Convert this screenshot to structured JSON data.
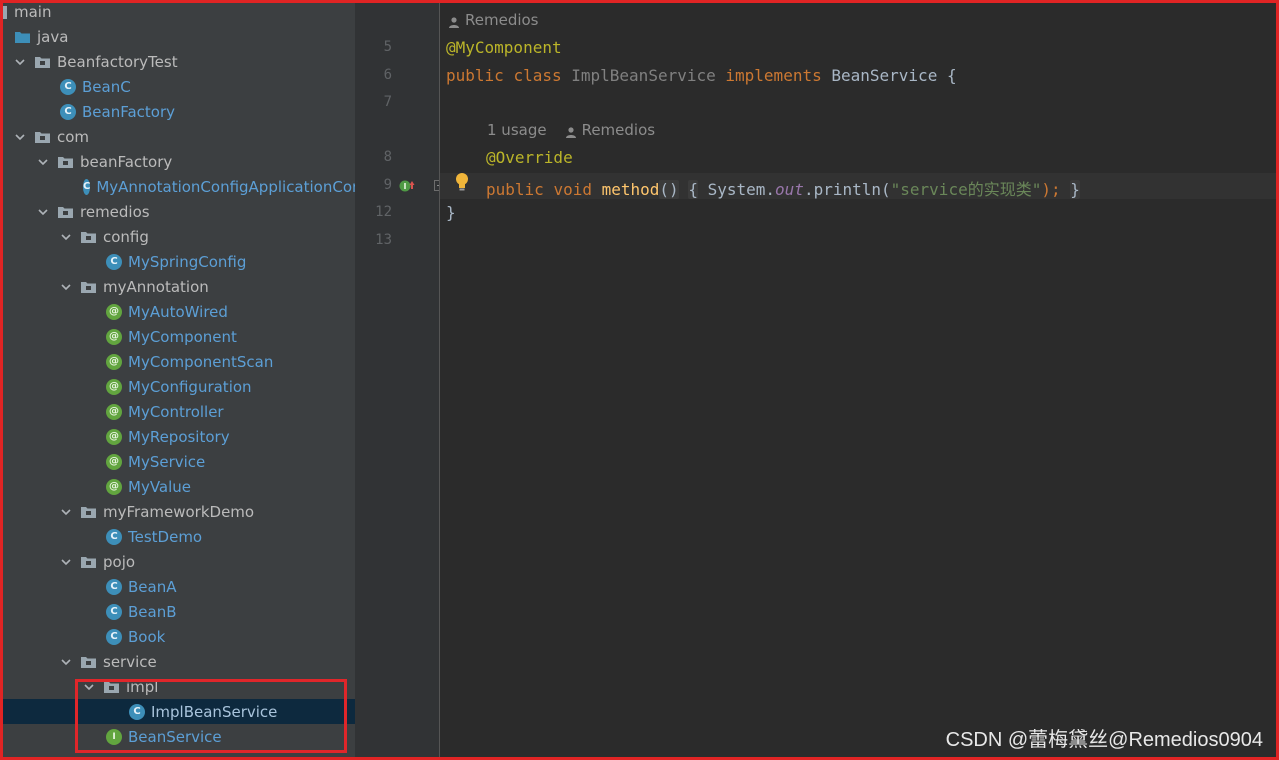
{
  "project_tree": {
    "items": [
      {
        "label": "main",
        "depth": 0,
        "icon": "module-folder-icon",
        "expanded": null
      },
      {
        "label": "java",
        "depth": 0,
        "icon": "source-folder-icon",
        "expanded": null
      },
      {
        "label": "BeanfactoryTest",
        "depth": 0,
        "icon": "package-icon",
        "expanded": true
      },
      {
        "label": "BeanC",
        "depth": 1,
        "icon": "class-icon",
        "expanded": null
      },
      {
        "label": "BeanFactory",
        "depth": 1,
        "icon": "class-icon",
        "expanded": null
      },
      {
        "label": "com",
        "depth": 0,
        "icon": "package-icon",
        "expanded": true
      },
      {
        "label": "beanFactory",
        "depth": 1,
        "icon": "package-icon",
        "expanded": true
      },
      {
        "label": "MyAnnotationConfigApplicationCon",
        "depth": 2,
        "icon": "class-icon",
        "expanded": null
      },
      {
        "label": "remedios",
        "depth": 1,
        "icon": "package-icon",
        "expanded": true
      },
      {
        "label": "config",
        "depth": 2,
        "icon": "package-icon",
        "expanded": true
      },
      {
        "label": "MySpringConfig",
        "depth": 3,
        "icon": "class-icon",
        "expanded": null
      },
      {
        "label": "myAnnotation",
        "depth": 2,
        "icon": "package-icon",
        "expanded": true
      },
      {
        "label": "MyAutoWired",
        "depth": 3,
        "icon": "annotation-icon",
        "expanded": null
      },
      {
        "label": "MyComponent",
        "depth": 3,
        "icon": "annotation-icon",
        "expanded": null
      },
      {
        "label": "MyComponentScan",
        "depth": 3,
        "icon": "annotation-icon",
        "expanded": null
      },
      {
        "label": "MyConfiguration",
        "depth": 3,
        "icon": "annotation-icon",
        "expanded": null
      },
      {
        "label": "MyController",
        "depth": 3,
        "icon": "annotation-icon",
        "expanded": null
      },
      {
        "label": "MyRepository",
        "depth": 3,
        "icon": "annotation-icon",
        "expanded": null
      },
      {
        "label": "MyService",
        "depth": 3,
        "icon": "annotation-icon",
        "expanded": null
      },
      {
        "label": "MyValue",
        "depth": 3,
        "icon": "annotation-icon",
        "expanded": null
      },
      {
        "label": "myFrameworkDemo",
        "depth": 2,
        "icon": "package-icon",
        "expanded": true
      },
      {
        "label": "TestDemo",
        "depth": 3,
        "icon": "class-icon",
        "expanded": null
      },
      {
        "label": "pojo",
        "depth": 2,
        "icon": "package-icon",
        "expanded": true
      },
      {
        "label": "BeanA",
        "depth": 3,
        "icon": "class-icon",
        "expanded": null
      },
      {
        "label": "BeanB",
        "depth": 3,
        "icon": "class-icon",
        "expanded": null
      },
      {
        "label": "Book",
        "depth": 3,
        "icon": "class-icon",
        "expanded": null
      },
      {
        "label": "service",
        "depth": 2,
        "icon": "package-icon",
        "expanded": true
      },
      {
        "label": "impl",
        "depth": 3,
        "icon": "package-icon",
        "expanded": true
      },
      {
        "label": "ImplBeanService",
        "depth": 4,
        "icon": "class-icon",
        "expanded": null,
        "selected": true
      },
      {
        "label": "BeanService",
        "depth": 3,
        "icon": "interface-icon",
        "expanded": null
      }
    ]
  },
  "editor": {
    "author_hint_top": "Remedios",
    "line_numbers": [
      "5",
      "6",
      "7",
      "8",
      "9",
      "12",
      "13"
    ],
    "line5": {
      "annotation": "@MyComponent"
    },
    "line6": {
      "kw1": "public",
      "kw2": "class",
      "classname": "ImplBeanService",
      "kw3": "implements",
      "iface": "BeanService",
      "brace": "{"
    },
    "usage_hint": {
      "usages": "1 usage",
      "author": "Remedios"
    },
    "line8": {
      "annotation": "@Override"
    },
    "line9": {
      "kw1": "public",
      "kw2": "void",
      "method": "method",
      "parens": "()",
      "open": "{",
      "system": "System.",
      "out": "out",
      "println": ".println(",
      "string": "\"service的实现类\"",
      "close_paren": ");",
      "close": "}"
    },
    "line12": {
      "brace": "}"
    }
  },
  "watermark": "CSDN @蕾梅黛丝@Remedios0904",
  "colors": {
    "tree_bg": "#3c3f41",
    "editor_bg": "#2b2b2b",
    "selection": "#0d293e",
    "keyword": "#cc7832",
    "annotation": "#bbb529",
    "string": "#6a8759",
    "highlight_box": "#e0262a"
  }
}
